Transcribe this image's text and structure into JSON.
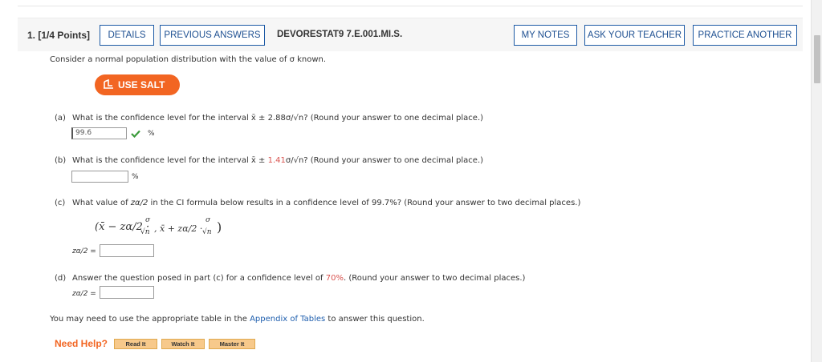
{
  "header": {
    "question_number": "1. [1/4 Points]",
    "details_label": "DETAILS",
    "previous_answers_label": "PREVIOUS ANSWERS",
    "code": "DEVORESTAT9 7.E.001.MI.S.",
    "my_notes_label": "MY NOTES",
    "ask_teacher_label": "ASK YOUR TEACHER",
    "practice_another_label": "PRACTICE ANOTHER"
  },
  "intro": "Consider a normal population distribution with the value of σ known.",
  "salt_label": "USE SALT",
  "parts": {
    "a": {
      "letter": "(a)",
      "q_prefix": "What is the confidence level for the interval",
      "q_interval": "x̄ ± 2.88σ/√n",
      "q_suffix": "? (Round your answer to one decimal place.)",
      "answer": "99.6",
      "unit": "%"
    },
    "b": {
      "letter": "(b)",
      "q_prefix": "What is the confidence level for the interval",
      "q_xbar": "x̄ ±",
      "q_coef": "1.41",
      "q_rest": "σ/√n",
      "q_suffix": "? (Round your answer to one decimal place.)",
      "answer": "",
      "unit": "%"
    },
    "c": {
      "letter": "(c)",
      "q_prefix": "What value of",
      "q_z": "zα/2",
      "q_suffix": "in the CI formula below results in a confidence level of 99.7%? (Round your answer to two decimal places.)",
      "formula_left": "(x̄ − zα/2 ·",
      "formula_mid": ", x̄ + zα/2 ·",
      "sigma": "σ",
      "sqrt_n": "√n",
      "close": ")",
      "answer_label": "zα/2 =",
      "answer": ""
    },
    "d": {
      "letter": "(d)",
      "q_prefix": "Answer the question posed in part (c) for a confidence level of",
      "q_level": "70%",
      "q_suffix": ". (Round your answer to two decimal places.)",
      "answer_label": "zα/2 =",
      "answer": ""
    }
  },
  "footer": {
    "prefix": "You may need to use the appropriate table in the",
    "link": "Appendix of Tables",
    "suffix": "to answer this question."
  },
  "need_help": {
    "label": "Need Help?",
    "read_it": "Read It",
    "watch_it": "Watch It",
    "master_it": "Master It"
  },
  "colors": {
    "accent": "#f26522",
    "link": "#1f5fae",
    "button_border": "#1d5aa5",
    "highlight": "#d9534f",
    "correct": "#3a9a3a"
  }
}
